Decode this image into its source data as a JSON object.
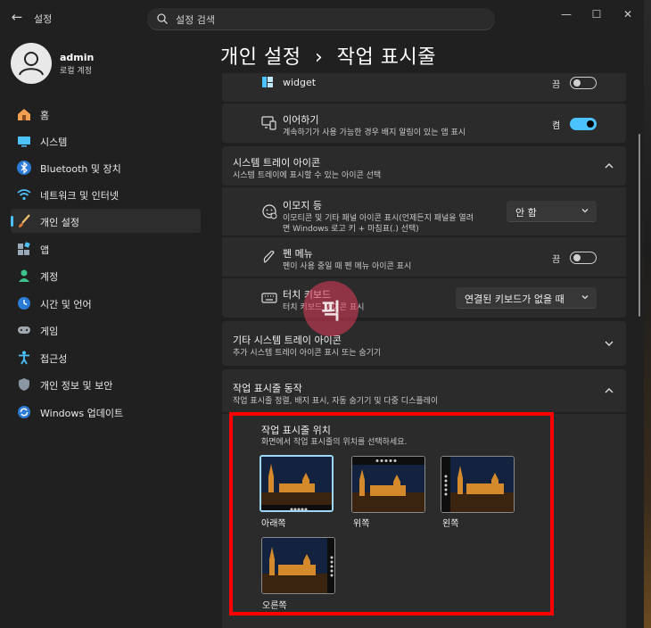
{
  "window": {
    "app_title": "설정",
    "back_label": "←",
    "minimize": "—",
    "maximize": "☐",
    "close": "✕"
  },
  "search": {
    "placeholder": "설정 검색"
  },
  "user": {
    "name": "admin",
    "account": "로컬 계정"
  },
  "nav": {
    "items": [
      {
        "label": "홈",
        "icon": "home-icon"
      },
      {
        "label": "시스템",
        "icon": "system-icon"
      },
      {
        "label": "Bluetooth 및 장치",
        "icon": "bluetooth-icon"
      },
      {
        "label": "네트워크 및 인터넷",
        "icon": "wifi-icon"
      },
      {
        "label": "개인 설정",
        "icon": "brush-icon",
        "active": true
      },
      {
        "label": "앱",
        "icon": "apps-icon"
      },
      {
        "label": "계정",
        "icon": "person-icon"
      },
      {
        "label": "시간 및 언어",
        "icon": "clock-globe-icon"
      },
      {
        "label": "게임",
        "icon": "gamepad-icon"
      },
      {
        "label": "접근성",
        "icon": "accessibility-icon"
      },
      {
        "label": "개인 정보 및 보안",
        "icon": "shield-icon"
      },
      {
        "label": "Windows 업데이트",
        "icon": "update-icon"
      }
    ]
  },
  "breadcrumb": {
    "parent": "개인 설정",
    "separator": "›",
    "current": "작업 표시줄"
  },
  "rows": {
    "widget": {
      "title": "widget",
      "state": "끔"
    },
    "continue": {
      "title": "이어하기",
      "subtitle": "계속하기가 사용 가능한 경우 배지 알림이 있는 앱 표시",
      "state": "켬"
    }
  },
  "tray": {
    "title": "시스템 트레이 아이콘",
    "subtitle": "시스템 트레이에 표시할 수 있는 아이콘 선택",
    "emoji": {
      "title": "이모지 등",
      "subtitle1": "이모티콘 및 기타 패널 아이콘 표시(언제든지 패널을 열려",
      "subtitle2": "면 Windows 로고 키 + 마침표(.) 선택)",
      "value": "안 함"
    },
    "pen": {
      "title": "펜 메뉴",
      "subtitle": "펜이 사용 중일 때 펜 메뉴 아이콘 표시",
      "state": "끔"
    },
    "touch": {
      "title": "터치 키보드",
      "subtitle": "터치 키보드 아이콘 표시",
      "value": "연결된 키보드가 없을 때"
    }
  },
  "other_tray": {
    "title": "기타 시스템 트레이 아이콘",
    "subtitle": "추가 시스템 트레이 아이콘 표시 또는 숨기기"
  },
  "behaviors": {
    "title": "작업 표시줄 동작",
    "subtitle": "작업 표시줄 정렬, 배지 표시, 자동 숨기기 및 다중 디스플레이",
    "position": {
      "title": "작업 표시줄 위치",
      "subtitle": "화면에서 작업 표시줄의 위치를 선택하세요.",
      "options": [
        {
          "label": "아래쪽",
          "selected": true
        },
        {
          "label": "위쪽"
        },
        {
          "label": "왼쪽"
        },
        {
          "label": "오른쪽"
        }
      ]
    }
  },
  "watermark": {
    "text": "픽"
  },
  "colors": {
    "accent": "#4cc2ff",
    "highlight": "#ff0000"
  }
}
